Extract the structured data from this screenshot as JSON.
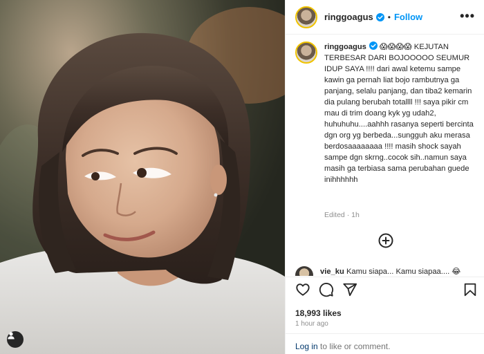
{
  "post": {
    "username": "ringgoagus",
    "follow_label": "Follow",
    "separator": "•",
    "caption_username": "ringgoagus",
    "caption_text": "😱😱😱😱 KEJUTAN TERBESAR DARI BOJOOOOO SEUMUR IDUP SAYA !!!! dari awal ketemu sampe kawin ga pernah liat bojo rambutnya ga panjang, selalu panjang, dan tiba2 kemarin dia pulang berubah totallll !!! saya pikir cm mau di trim doang kyk yg udah2, huhuhuhu....aahhh rasanya seperti bercinta dgn org yg berbeda...sungguh aku merasa berdosaaaaaaaa !!!! masih shock sayah sampe dgn skrng..cocok sih..namun saya masih ga terbiasa sama perubahan guede inihhhhhh",
    "edited_label": "Edited · 1h",
    "comment_username": "vie_ku",
    "comment_text": "Kamu siapa... Kamu siapaa.... 😂",
    "likes_label": "18,993 likes",
    "time_label": "1 hour ago",
    "login_link": "Log in",
    "login_suffix": " to like or comment."
  },
  "icons": {
    "verified": "verified-badge-icon",
    "more": "more-options-icon",
    "load_more": "plus-circle-icon",
    "like": "heart-icon",
    "comment": "comment-icon",
    "share": "share-icon",
    "save": "bookmark-icon",
    "user_tags": "user-tags-icon"
  },
  "colors": {
    "accent_blue": "#0095f6",
    "link_dark_blue": "#00376b",
    "text": "#262626",
    "muted": "#8e8e8e"
  }
}
